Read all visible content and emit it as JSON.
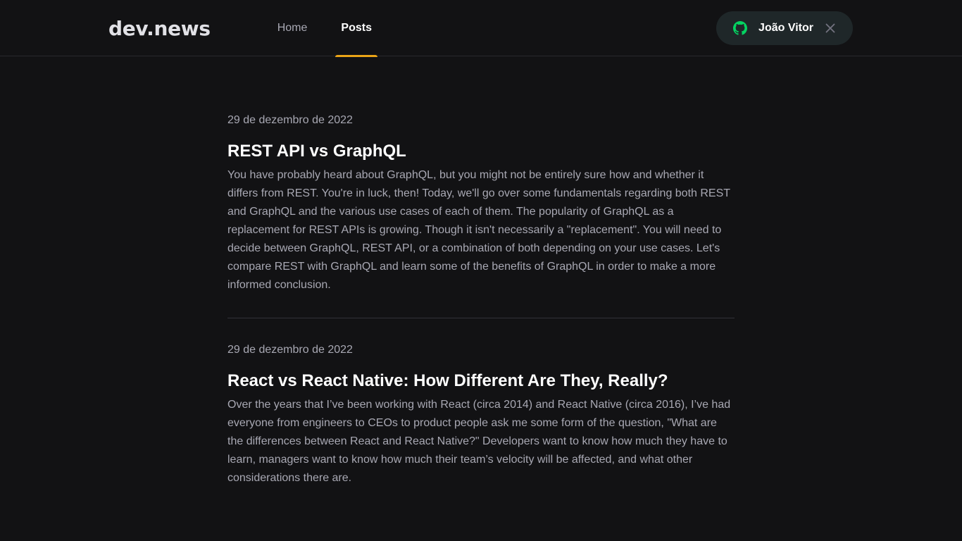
{
  "header": {
    "logo": "dev.news",
    "nav": [
      {
        "label": "Home",
        "active": false
      },
      {
        "label": "Posts",
        "active": true
      }
    ],
    "user": {
      "name": "João Vitor",
      "icon": "github-icon",
      "icon_color": "#04d361",
      "close_icon": "close-icon"
    }
  },
  "colors": {
    "background": "#121214",
    "accent": "#eba417",
    "text": "#e1e1e6",
    "muted": "#a8a8b3"
  },
  "posts": [
    {
      "date": "29 de dezembro de 2022",
      "title": "REST API vs GraphQL",
      "excerpt": "You have probably heard about GraphQL, but you might not be entirely sure how and whether it differs from REST. You're in luck, then! Today, we'll go over some fundamentals regarding both REST and GraphQL and the various use cases of each of them. The popularity of GraphQL as a replacement for REST APIs is growing. Though it isn't necessarily a \"replacement\". You will need to decide between GraphQL, REST API, or a combination of both depending on your use cases. Let's compare REST with GraphQL and learn some of the benefits of GraphQL in order to make a more informed conclusion."
    },
    {
      "date": "29 de dezembro de 2022",
      "title": "React vs React Native: How Different Are They, Really?",
      "excerpt": "Over the years that I’ve been working with React (circa 2014) and React Native (circa 2016), I’ve had everyone from engineers to CEOs to product people ask me some form of the question, \"What are the differences between React and React Native?\" Developers want to know how much they have to learn, managers want to know how much their team’s velocity will be affected, and what other considerations there are."
    }
  ]
}
